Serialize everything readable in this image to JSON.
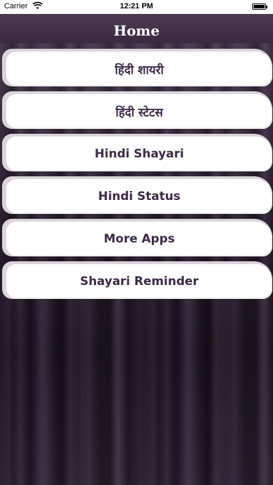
{
  "status_bar": {
    "carrier": "Carrier",
    "time": "12:21 PM",
    "wifi_icon": "wifi-icon",
    "battery_icon": "battery-icon"
  },
  "nav": {
    "title": "Home"
  },
  "menu": {
    "items": [
      {
        "label": "हिंदी शायरी"
      },
      {
        "label": "हिंदी स्टेटस"
      },
      {
        "label": "Hindi Shayari"
      },
      {
        "label": "Hindi Status"
      },
      {
        "label": "More Apps"
      },
      {
        "label": "Shayari Reminder"
      }
    ]
  },
  "colors": {
    "nav_bg": "#4c3a52",
    "button_text": "#3d2848",
    "button_bg": "#ffffff"
  }
}
